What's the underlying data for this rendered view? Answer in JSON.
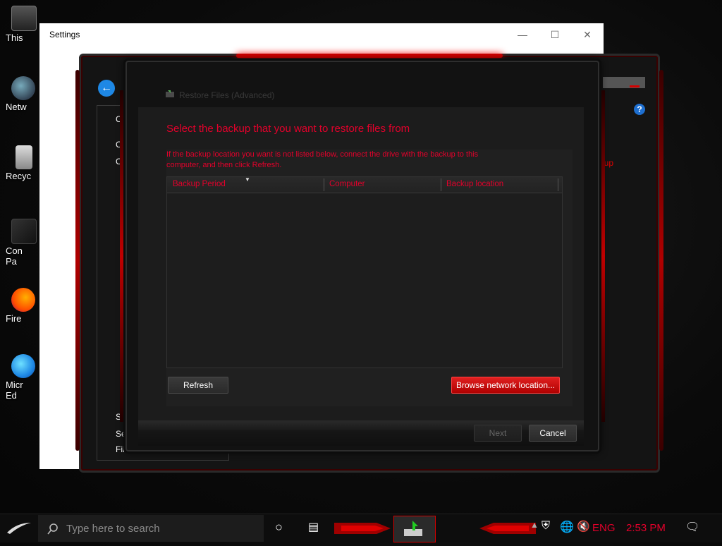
{
  "desktop": {
    "icons": [
      {
        "label": "This",
        "name": "this-pc"
      },
      {
        "label": "Netw",
        "name": "network"
      },
      {
        "label": "Recyc",
        "name": "recycle-bin"
      },
      {
        "label": "Con Pa",
        "name": "control-panel"
      },
      {
        "label": "Fire",
        "name": "firefox"
      },
      {
        "label": "Micr Ed",
        "name": "microsoft-edge"
      }
    ]
  },
  "settings_window": {
    "title": "Settings",
    "controls": {
      "minimize": "—",
      "maximize": "☐",
      "close": "✕"
    }
  },
  "control_panel": {
    "side_items": [
      "Co",
      "Cre",
      "Cre",
      "Se",
      "Se",
      "File"
    ],
    "right_link": "ackup",
    "help": "?"
  },
  "dialog": {
    "title": "Restore Files (Advanced)",
    "heading": "Select the backup that you want to restore files from",
    "info_line1": "If the backup location you want is not listed below, connect the drive with the backup to this",
    "info_line2": "computer, and then click Refresh.",
    "columns": [
      "Backup Period",
      "Computer",
      "Backup location"
    ],
    "refresh_label": "Refresh",
    "browse_label": "Browse network location...",
    "next_label": "Next",
    "cancel_label": "Cancel"
  },
  "taskbar": {
    "search_placeholder": "Type here to search",
    "language": "ENG",
    "time": "2:53 PM"
  },
  "colors": {
    "accent": "#e4002b",
    "dark": "#121212"
  }
}
